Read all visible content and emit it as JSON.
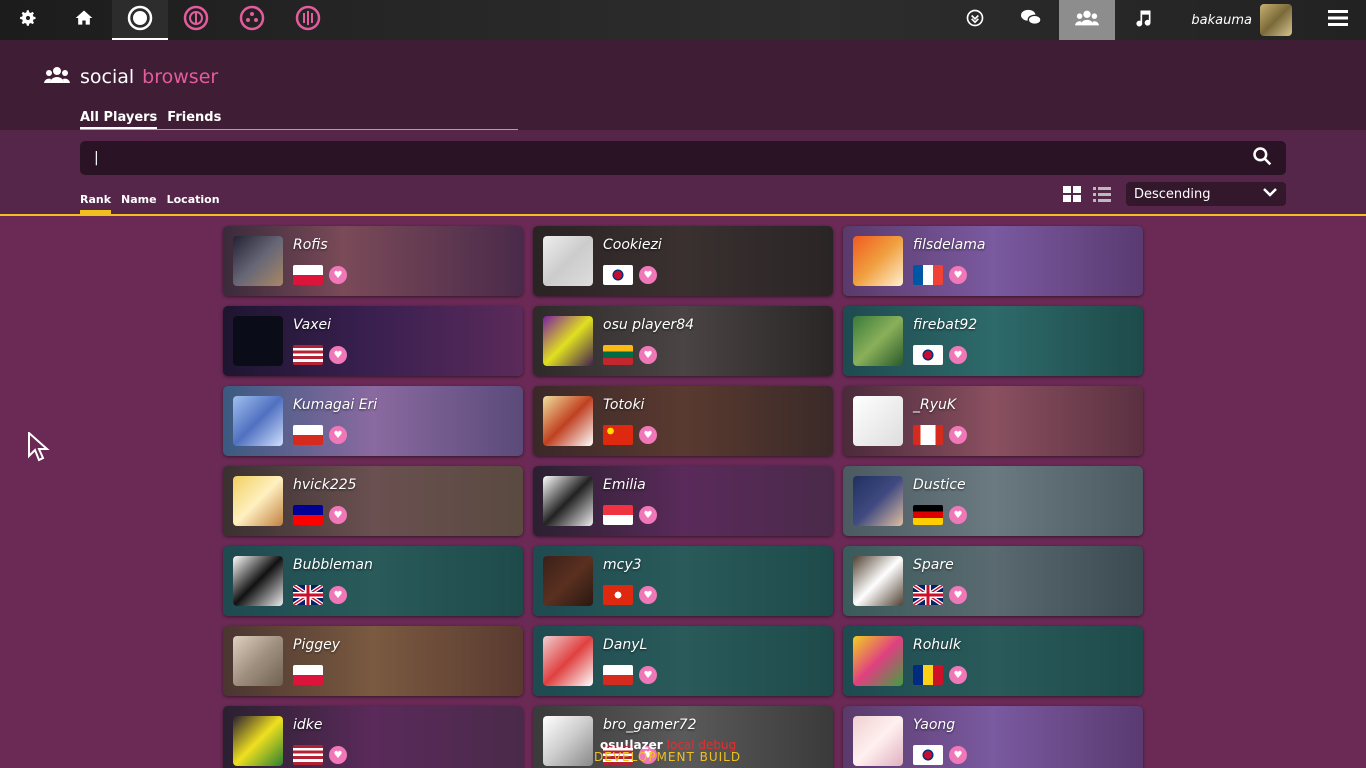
{
  "toolbar": {
    "left_icons": [
      "gear-icon",
      "home-icon",
      "osu-ruleset-icon",
      "taiko-ruleset-icon",
      "catch-ruleset-icon",
      "mania-ruleset-icon"
    ],
    "right_icons": [
      "download-icon",
      "chat-icon",
      "social-icon",
      "music-icon"
    ],
    "username": "bakauma",
    "menu_icon": "hamburger-icon"
  },
  "header": {
    "title": "social",
    "subtitle": "browser",
    "tabs": [
      "All Players",
      "Friends"
    ]
  },
  "filter": {
    "search_value": "|",
    "sort_tabs": [
      "Rank",
      "Name",
      "Location"
    ],
    "sort_dropdown": "Descending"
  },
  "players": [
    {
      "name": "Rofis",
      "country": "PL"
    },
    {
      "name": "Cookiezi",
      "country": "KR"
    },
    {
      "name": "filsdelama",
      "country": "FR"
    },
    {
      "name": "Vaxei",
      "country": "US"
    },
    {
      "name": "osu player84",
      "country": "LT"
    },
    {
      "name": "firebat92",
      "country": "KR"
    },
    {
      "name": "Kumagai Eri",
      "country": "CL"
    },
    {
      "name": "Totoki",
      "country": "CN"
    },
    {
      "name": "_RyuK",
      "country": "CA"
    },
    {
      "name": "hvick225",
      "country": "TW"
    },
    {
      "name": "Emilia",
      "country": "SG"
    },
    {
      "name": "Dustice",
      "country": "DE"
    },
    {
      "name": "Bubbleman",
      "country": "GB"
    },
    {
      "name": "mcy3",
      "country": "HK"
    },
    {
      "name": "Spare",
      "country": "GB"
    },
    {
      "name": "Piggey",
      "country": "PL"
    },
    {
      "name": "DanyL",
      "country": "CL"
    },
    {
      "name": "Rohulk",
      "country": "RO"
    },
    {
      "name": "idke",
      "country": "US"
    },
    {
      "name": "bro_gamer72",
      "country": "US"
    },
    {
      "name": "Yaong",
      "country": "KR"
    }
  ],
  "overlay": {
    "app": "osu!lazer",
    "debug": "local debug",
    "build": "DEVELOPMENT BUILD"
  }
}
